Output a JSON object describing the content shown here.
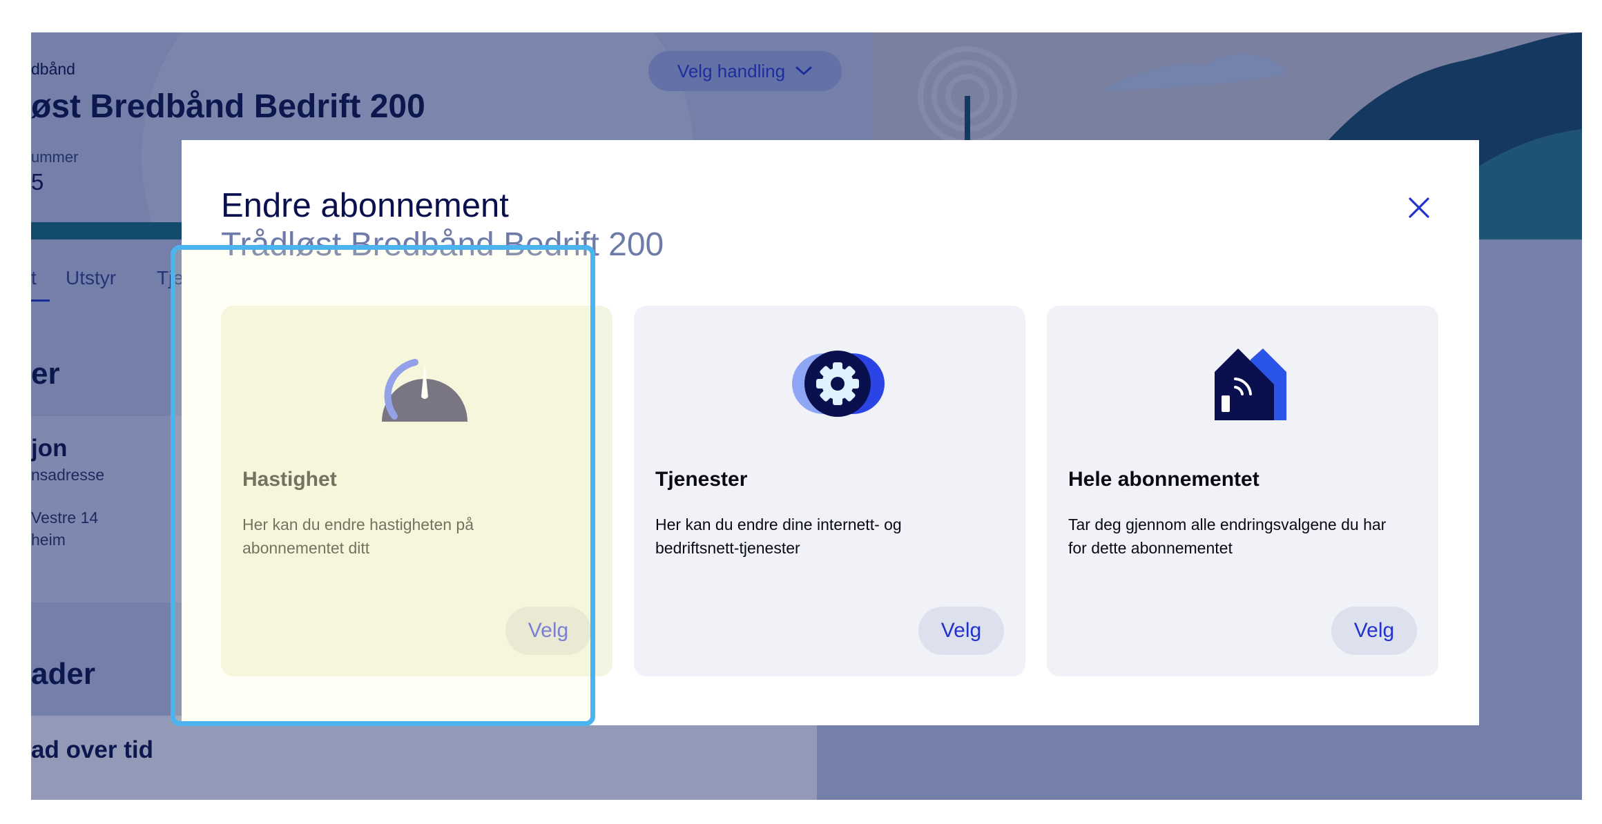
{
  "header": {
    "breadcrumb": "dbånd",
    "title": "øst Bredbånd Bedrift 200",
    "number_label": "ummer",
    "number_value": "5",
    "action_button": "Velg handling"
  },
  "tabs": [
    {
      "label": "t"
    },
    {
      "label": "Utstyr"
    },
    {
      "label": "Tje"
    }
  ],
  "sections": {
    "first_heading": "er",
    "info_heading": "jon",
    "info_label": "nsadresse",
    "info_line1": "Vestre 14",
    "info_line2": "heim",
    "second_heading": "ader",
    "third_heading": "ad over tid"
  },
  "modal": {
    "title": "Endre abonnement",
    "subtitle": "Trådløst Bredbånd Bedrift 200",
    "close_icon": "close-icon",
    "cards": [
      {
        "title": "Hastighet",
        "description": "Her kan du endre hastigheten på abonnementet ditt",
        "button": "Velg",
        "icon": "speedometer-icon"
      },
      {
        "title": "Tjenester",
        "description": "Her kan du endre dine internett- og bedriftsnett-tjenester",
        "button": "Velg",
        "icon": "gear-icon"
      },
      {
        "title": "Hele abonnementet",
        "description": "Tar deg gjennom alle endringsvalgene du har for dette abonnementet",
        "button": "Velg",
        "icon": "wireless-house-icon"
      }
    ]
  },
  "colors": {
    "accent": "#2233cc",
    "dark_navy": "#0a0f4e",
    "highlight_outline": "#4bb4ee",
    "teal": "#167079"
  }
}
